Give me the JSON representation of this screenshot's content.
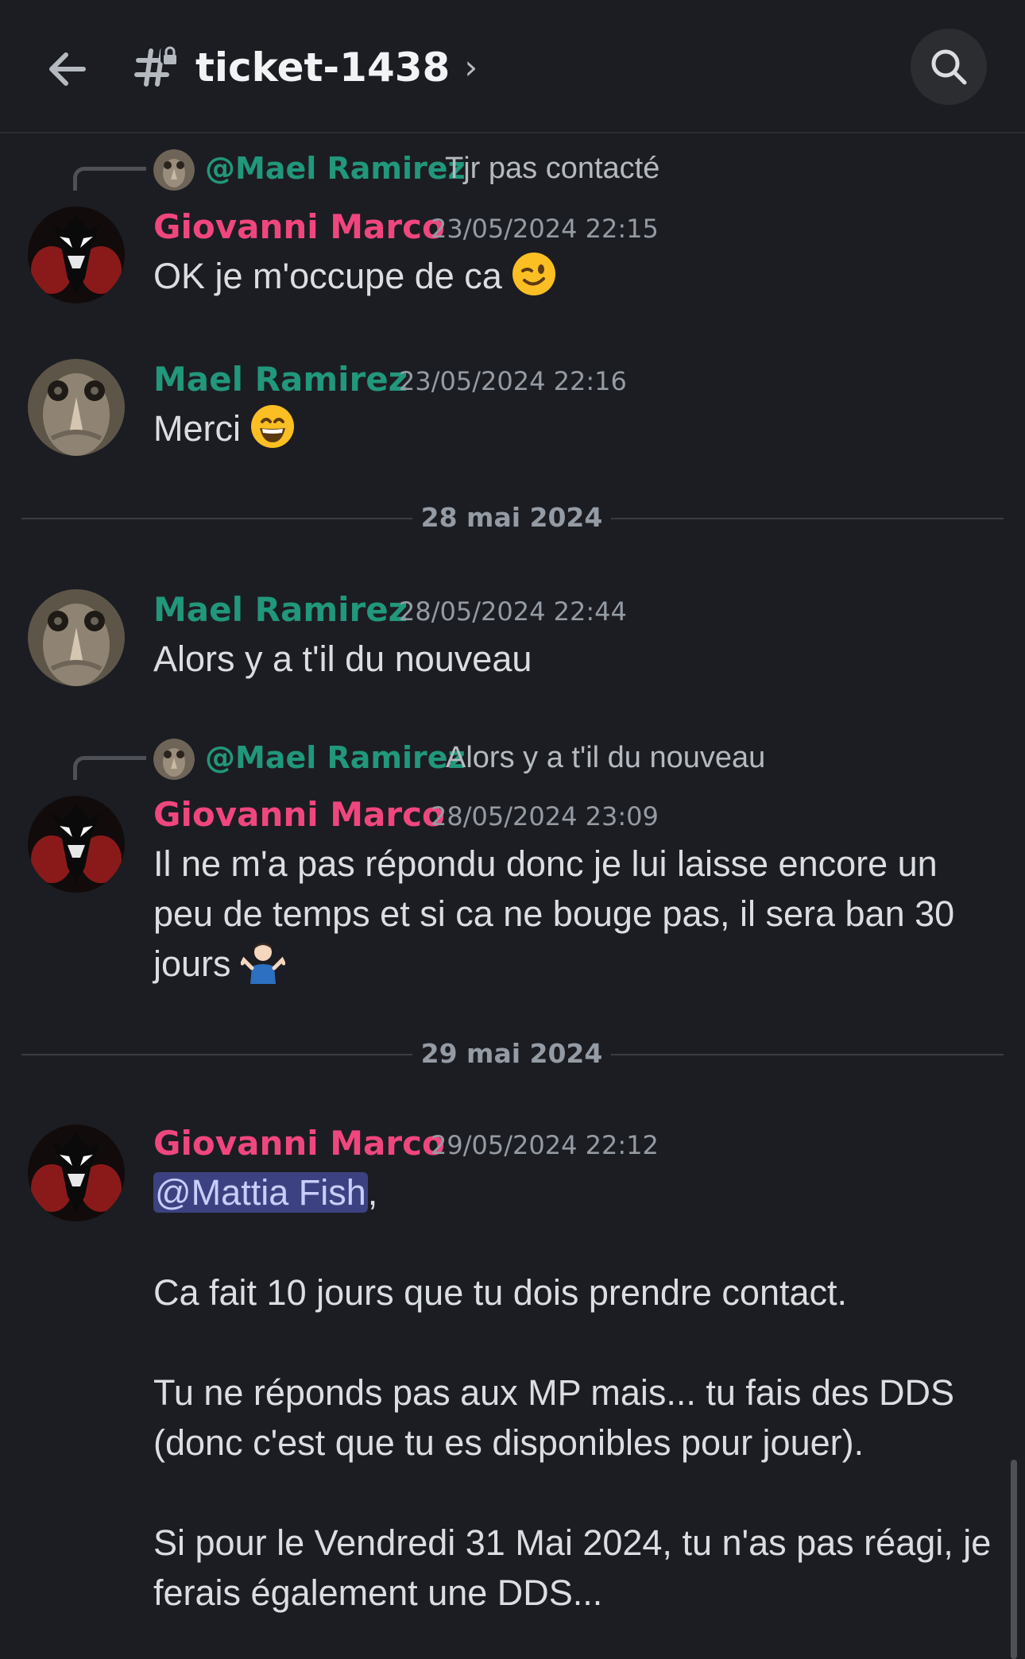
{
  "header": {
    "back_icon": "arrow-left-icon",
    "channel_icon": "locked-hashtag-icon",
    "channel_name": "ticket-1438",
    "chevron": "›",
    "search_icon": "search-icon"
  },
  "messages": [
    {
      "reply_to": {
        "name": "@Mael Ramirez",
        "text": "Tjr pas contacté"
      },
      "author": "Giovanni Marco",
      "timestamp": "23/05/2024 22:15",
      "text": "OK je m'occupe de ca",
      "emoji": "winking-face-emoji"
    },
    {
      "author": "Mael Ramirez",
      "timestamp": "23/05/2024 22:16",
      "text": "Merci",
      "emoji": "grinning-face-emoji"
    },
    {
      "author": "Mael Ramirez",
      "timestamp": "28/05/2024 22:44",
      "text": "Alors y a t'il du nouveau"
    },
    {
      "reply_to": {
        "name": "@Mael Ramirez",
        "text": "Alors y a t'il du nouveau"
      },
      "author": "Giovanni Marco",
      "timestamp": "28/05/2024 23:09",
      "text_line1": "Il ne m'a pas répondu donc je lui laisse encore un",
      "text_line2": "peu de temps et si ca ne bouge pas, il sera ban 30",
      "text_line3": "jours",
      "emoji": "person-shrugging-emoji"
    },
    {
      "author": "Giovanni Marco",
      "timestamp": "29/05/2024 22:12",
      "mention": "@Mattia Fish",
      "after_mention": ",",
      "para1": "Ca fait 10 jours que tu dois prendre contact.",
      "para2_line1": "Tu ne réponds pas aux MP mais... tu fais des DDS",
      "para2_line2": "(donc c'est que tu es disponibles pour jouer).",
      "para3_line1": "Si pour le Vendredi 31 Mai 2024, tu n'as pas réagi, je",
      "para3_line2": "ferais également une DDS..."
    }
  ],
  "dividers": [
    "28 mai 2024",
    "29 mai 2024"
  ],
  "colors": {
    "background": "#1c1d22",
    "giovanni_name": "#f0467e",
    "mael_name": "#21977b",
    "mention_bg": "#3c4281"
  }
}
